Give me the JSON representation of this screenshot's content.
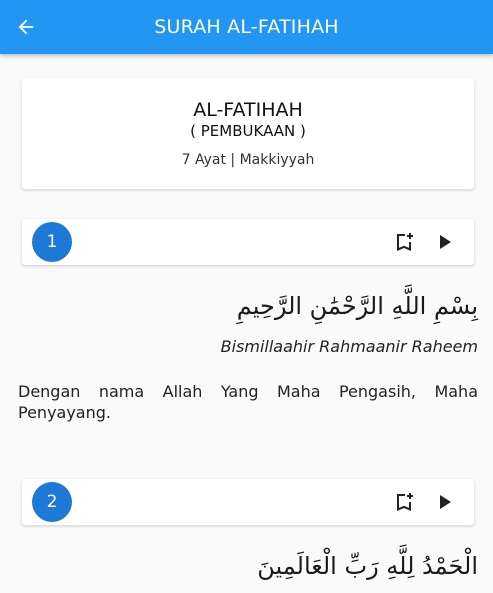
{
  "appbar": {
    "title": "SURAH AL-FATIHAH",
    "back_icon": "arrow-left-icon",
    "color": "#2196f3"
  },
  "surah": {
    "name": "AL-FATIHAH",
    "meaning": "( PEMBUKAAN )",
    "meta": "7 Ayat | Makkiyyah"
  },
  "ayahs": [
    {
      "number": "1",
      "arabic": "بِسْمِ اللَّهِ الرَّحْمَٰنِ الرَّحِيمِ",
      "latin": "Bismillaahir Rahmaanir Raheem",
      "translation": "Dengan nama Allah Yang Maha Pengasih, Maha Penyayang."
    },
    {
      "number": "2",
      "arabic": "الْحَمْدُ لِلَّهِ رَبِّ الْعَالَمِينَ"
    }
  ],
  "accent_color": "#1e78d6",
  "icons": {
    "bookmark": "bookmark-add-icon",
    "play": "play-icon"
  }
}
